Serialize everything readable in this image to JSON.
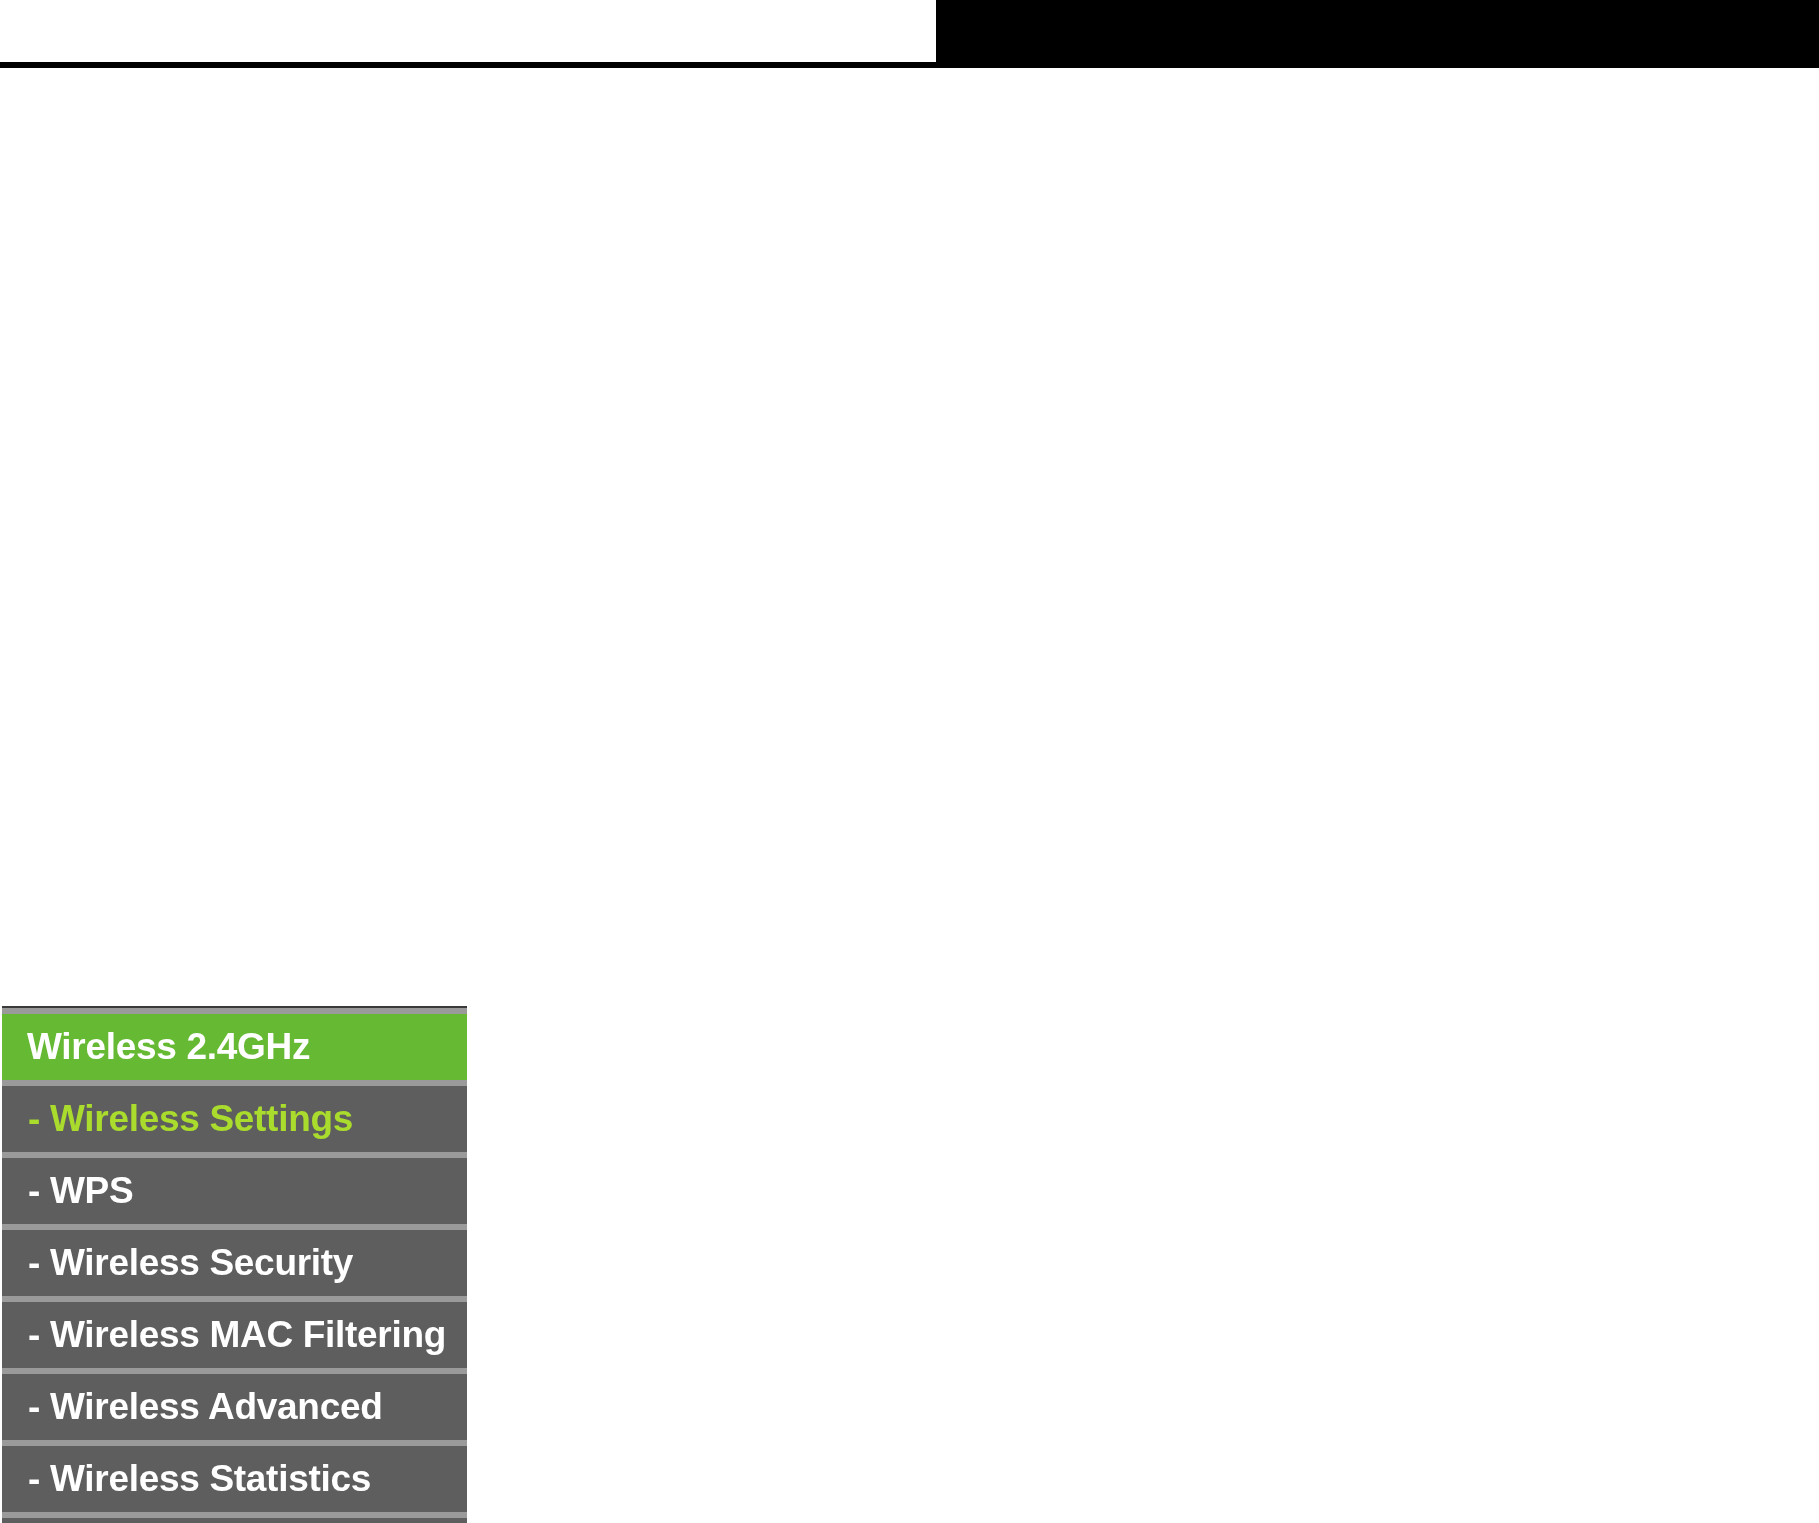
{
  "sidebar": {
    "heading": "Wireless 2.4GHz",
    "items": [
      {
        "label": "- Wireless Settings",
        "selected": true
      },
      {
        "label": "- WPS",
        "selected": false
      },
      {
        "label": "- Wireless Security",
        "selected": false
      },
      {
        "label": "- Wireless MAC Filtering",
        "selected": false
      },
      {
        "label": "- Wireless Advanced",
        "selected": false
      },
      {
        "label": "- Wireless Statistics",
        "selected": false
      }
    ]
  }
}
